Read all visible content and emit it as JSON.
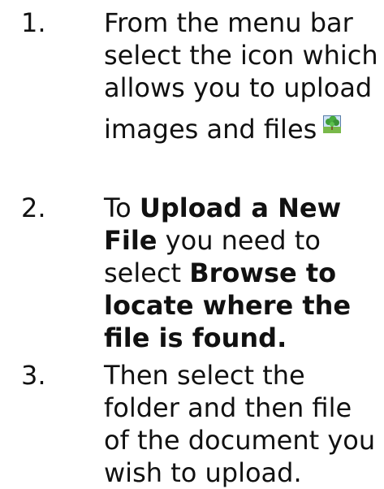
{
  "steps": [
    {
      "number": "1.",
      "line1": "From the menu bar",
      "line2": "select the icon which",
      "line3": "allows you to upload",
      "line4": "images and files",
      "icon": "image-upload-icon"
    },
    {
      "number": "2.",
      "prefix": "To ",
      "bold1": "Upload a New File",
      "mid": " you need to select ",
      "bold2": "Browse to locate where the file is found."
    },
    {
      "number": "3.",
      "text": "Then select the folder and then file of the document you wish to upload."
    }
  ]
}
